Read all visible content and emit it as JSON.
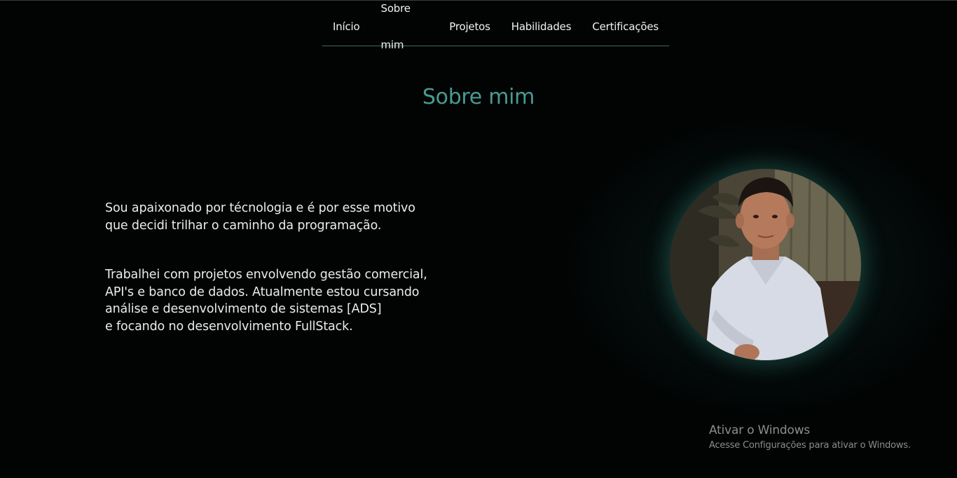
{
  "nav": {
    "items": [
      {
        "label": "Início"
      },
      {
        "label": "Sobre mim"
      },
      {
        "label": "Projetos"
      },
      {
        "label": "Habilidades"
      },
      {
        "label": "Certificações"
      }
    ]
  },
  "about": {
    "title": "Sobre mim",
    "paragraph1_line1": "Sou apaixonado por técnologia e é por esse motivo",
    "paragraph1_line2": "que decidi trilhar o caminho da programação.",
    "paragraph2_line1": "Trabalhei com projetos envolvendo gestão comercial,",
    "paragraph2_line2": "API's e banco de dados. Atualmente estou cursando",
    "paragraph2_line3": "análise e desenvolvimento de sistemas [ADS]",
    "paragraph2_line4": "e focando no desenvolvimento FullStack."
  },
  "watermark": {
    "title": "Ativar o Windows",
    "subtitle": "Acesse Configurações para ativar o Windows."
  },
  "colors": {
    "background": "#020303",
    "accent": "#4a9a92",
    "text": "#ececec"
  }
}
